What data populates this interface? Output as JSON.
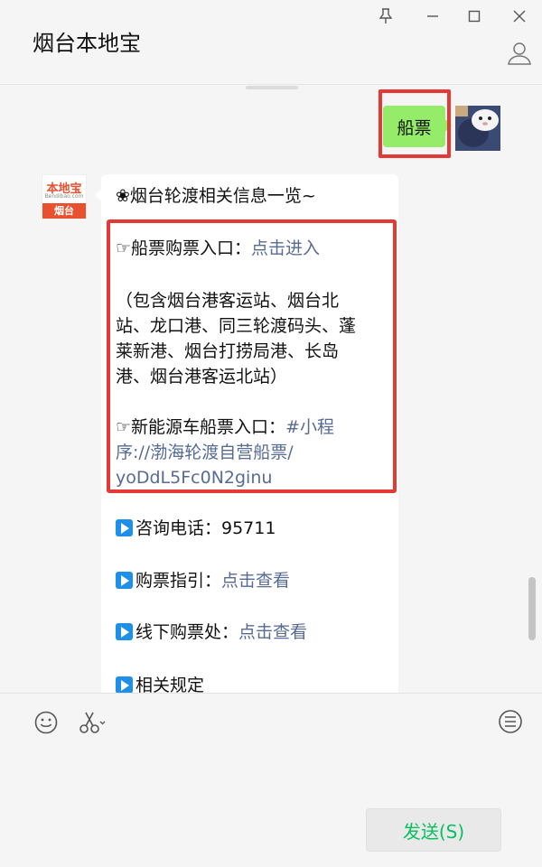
{
  "window": {
    "title": "烟台本地宝"
  },
  "outgoing": {
    "text": "船票"
  },
  "bot_logo": {
    "brand": "本地宝",
    "domain": "Bendibao.com",
    "city": "烟台"
  },
  "incoming": {
    "header": "❀烟台轮渡相关信息一览~",
    "ticket_label": "☞船票购票入口：",
    "ticket_link": "点击进入",
    "coverage_lines": [
      "（包含烟台港客运站、烟台北",
      "站、龙口港、同三轮渡码头、蓬",
      "莱新港、烟台打捞局港、长岛",
      "港、烟台港客运北站）"
    ],
    "ev_label": "☞新能源车船票入口：",
    "ev_link_lines": [
      "#小程",
      "序://渤海轮渡自营船票/",
      "yoDdL5Fc0N2ginu"
    ],
    "phone": "咨询电话：95711",
    "guide_label": "购票指引：",
    "guide_link": "点击查看",
    "offline_label": "线下购票处：",
    "offline_link": "点击查看",
    "rules_label": "相关规定"
  },
  "input": {
    "send_label": "发送(S)"
  },
  "colors": {
    "accent_green": "#07c160",
    "bubble_green": "#95ec69",
    "link": "#576b95",
    "highlight_red": "#e53935"
  }
}
